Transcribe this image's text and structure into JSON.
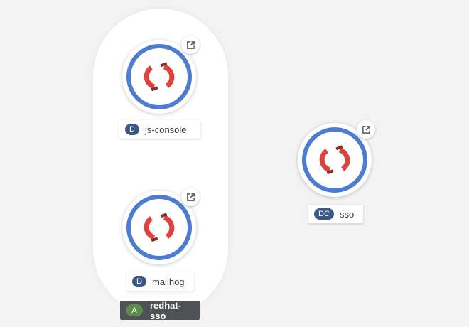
{
  "topology": {
    "application_group": {
      "badge": "A",
      "name": "redhat-sso"
    },
    "nodes": [
      {
        "kind_badge": "D",
        "name": "js-console",
        "badge_color": "#3b5785"
      },
      {
        "kind_badge": "D",
        "name": "mailhog",
        "badge_color": "#3b5785"
      },
      {
        "kind_badge": "DC",
        "name": "sso",
        "badge_color": "#3b5785"
      }
    ],
    "icons": {
      "node_logo": "openshift-logo-icon",
      "external_link": "external-link-icon"
    },
    "colors": {
      "ring": "#4d7cd1",
      "logo": "#d9443f",
      "group_label_bg": "#4f5255",
      "application_badge": "#5a8c4e"
    }
  }
}
